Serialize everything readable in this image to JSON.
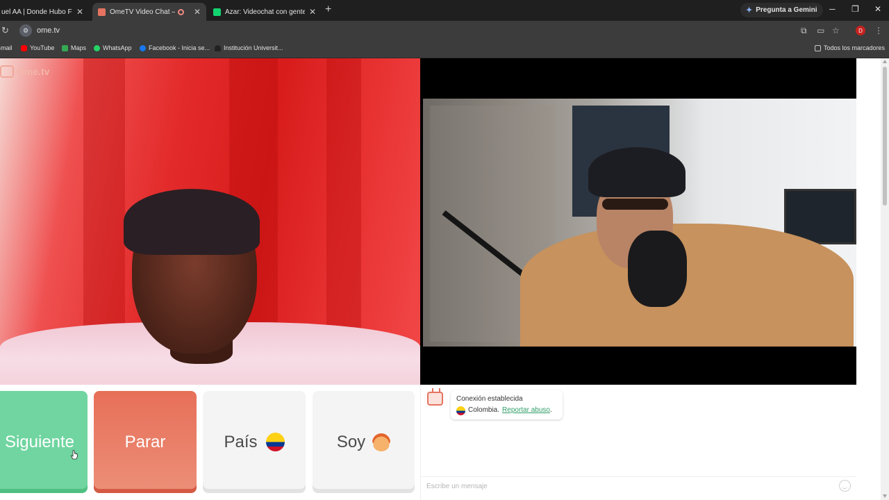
{
  "browser": {
    "tabs": [
      {
        "title": "uel AA | Donde Hubo Fuego",
        "favicon_color": "#ff0000"
      },
      {
        "title": "OmeTV Video Chat — Ome",
        "favicon_color": "#e57360"
      },
      {
        "title": "Azar: Videochat con gente nue",
        "favicon_color": "#12d36f"
      }
    ],
    "new_tab_label": "+",
    "gemini_label": "Pregunta a Gemini",
    "url": "ome.tv",
    "bookmarks": [
      {
        "label": "Gmail",
        "color": "#ea4335"
      },
      {
        "label": "YouTube",
        "color": "#ff0000"
      },
      {
        "label": "Maps",
        "color": "#34a853"
      },
      {
        "label": "WhatsApp",
        "color": "#25d366"
      },
      {
        "label": "Facebook - Inicia se...",
        "color": "#1877f2"
      },
      {
        "label": "Institución Universit...",
        "color": "#222222"
      }
    ],
    "all_bookmarks_label": "Todos los marcadores",
    "profile_initial": "D"
  },
  "app": {
    "logo_text": "Ome.tv",
    "buttons": {
      "next": "Siguiente",
      "stop": "Parar",
      "country": "País",
      "me": "Soy"
    },
    "chat": {
      "status": "Conexión establecida",
      "country": "Colombia.",
      "report": "Reportar abuso",
      "report_suffix": ".",
      "input_placeholder": "Escribe un mensaje"
    },
    "colors": {
      "next": "#70d5a0",
      "stop": "#e76f58",
      "link": "#2f9e68"
    }
  }
}
